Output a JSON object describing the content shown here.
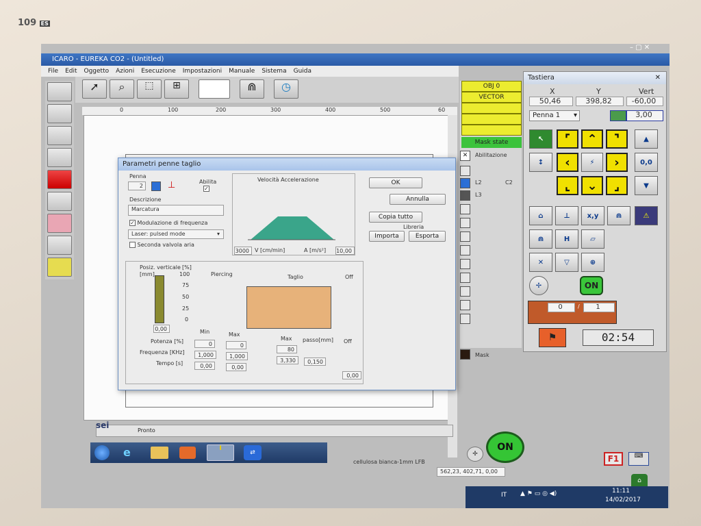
{
  "monitor": {
    "model": "109",
    "badge": "ES"
  },
  "window": {
    "title": "ICARO - EUREKA CO2 - (Untitled)"
  },
  "menu": [
    "File",
    "Edit",
    "Oggetto",
    "Azioni",
    "Esecuzione",
    "Impostazioni",
    "Manuale",
    "Sistema",
    "Guida"
  ],
  "ruler": [
    "0",
    "100",
    "200",
    "300",
    "400",
    "500",
    "60"
  ],
  "layers": {
    "header": [
      "OBJ 0",
      "VECTOR"
    ],
    "mask_state": "Mask state",
    "abilitazione": "Abilitazione",
    "l2": "L2",
    "c2": "C2",
    "l3": "L3",
    "mask": "Mask",
    "colors": {
      "l2": "#2b6fd6",
      "l3": "#555555",
      "mask": "#2a1a10",
      "yellow": "#ecec30"
    }
  },
  "dialog": {
    "title": "Parametri penne taglio",
    "penna_label": "Penna",
    "penna_value": "2",
    "abilita_label": "Abilita",
    "descrizione_label": "Descrizione",
    "descrizione_value": "Marcatura",
    "modulazione": "Modulazione di frequenza",
    "mode": "Laser: pulsed mode",
    "seconda_valvola": "Seconda valvola aria",
    "vel_title": "Velocità  Accelerazione",
    "v_value": "3000",
    "v_unit": "V [cm/min]",
    "a_unit": "A [m/s²]",
    "a_value": "10,00",
    "ok": "OK",
    "annulla": "Annulla",
    "copia": "Copia tutto",
    "libreria": "Libreria",
    "importa": "Importa",
    "esporta": "Esporta",
    "posiz": "Posiz. verticale",
    "mm": "[mm]",
    "pct": "[%]",
    "scale": [
      "100",
      "75",
      "50",
      "25",
      "0"
    ],
    "posiz_value": "0,00",
    "piercing": "Piercing",
    "taglio": "Taglio",
    "off": "Off",
    "min": "Min",
    "max": "Max",
    "max2": "Max",
    "passo": "passo[mm]",
    "off2": "Off",
    "potenza": "Potenza [%]",
    "frequenza": "Frequenza [KHz]",
    "tempo": "Tempo [s]",
    "p_min": "0",
    "p_max": "0",
    "t_max": "80",
    "f_min": "1,000",
    "f_max": "1,000",
    "f_taglio": "3,330",
    "f_passo": "0,150",
    "tm_min": "0,00",
    "tm_max": "0,00",
    "off_val": "0,00",
    "chart_color": "#3aa58a",
    "taglio_color": "#e7b27a"
  },
  "tastiera": {
    "title": "Tastiera",
    "x_label": "X",
    "y_label": "Y",
    "vert_label": "Vert",
    "x_value": "50,46",
    "y_value": "398,82",
    "vert_value": "-60,00",
    "step_value": "3,00",
    "penna": "Penna 1",
    "on": "ON",
    "counter_left": "0",
    "slash": "/",
    "counter_right": "1",
    "timer": "02:54"
  },
  "status": {
    "prompt": "Pronto",
    "material": "cellulosa bianca-1mm LFB",
    "coords": "562,23, 402,71, 0,00",
    "on_big": "ON",
    "f1": "F1"
  },
  "taskbar": {
    "lang": "IT",
    "time": "11:11",
    "date": "14/02/2017"
  }
}
